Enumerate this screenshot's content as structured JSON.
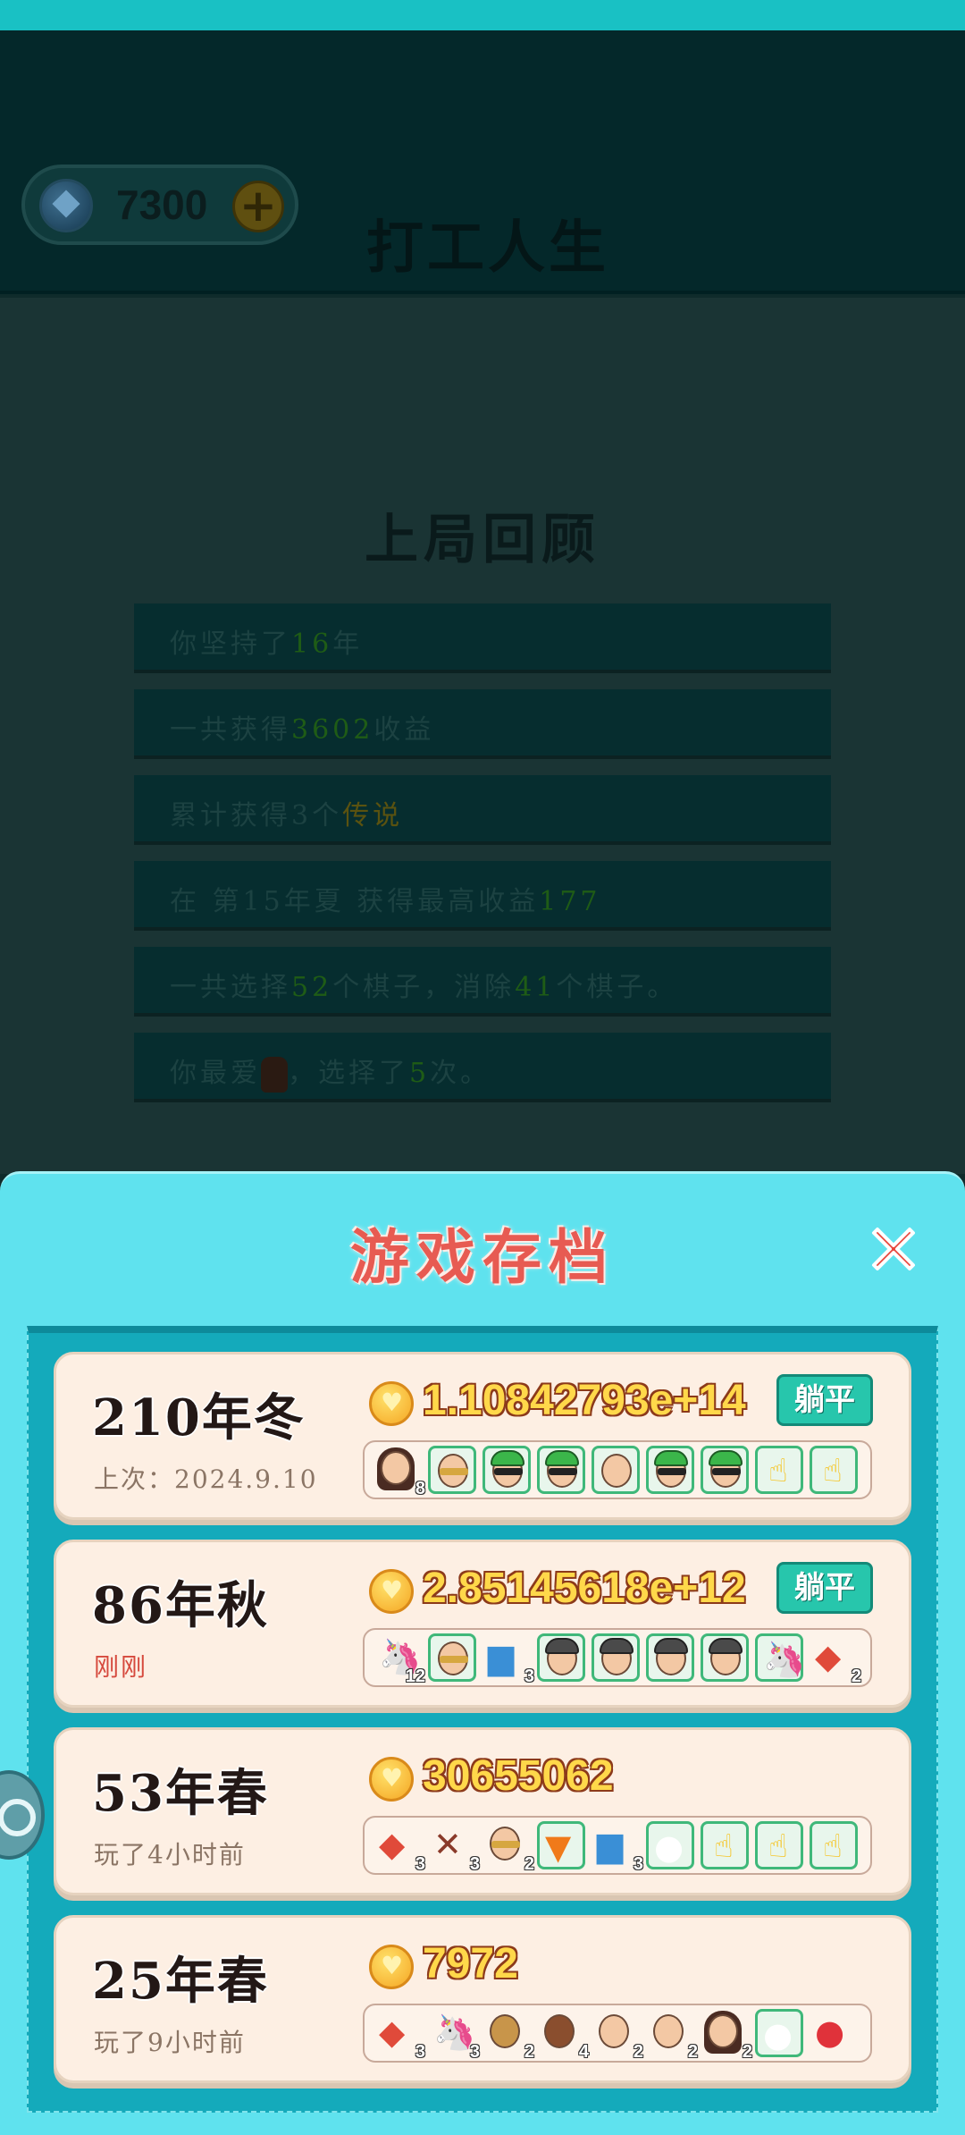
{
  "header": {
    "currency_value": "7300",
    "title": "打工人生"
  },
  "review": {
    "title": "上局回顾",
    "rows": [
      {
        "pre": "你坚持了",
        "hl": "16",
        "post": "年"
      },
      {
        "pre": "一共获得",
        "hl": "3602",
        "post": "收益"
      },
      {
        "pre": "累计获得3个",
        "hl": "传说",
        "post": ""
      },
      {
        "pre": "在 第15年夏 获得最高收益",
        "hl": "177",
        "post": ""
      },
      {
        "pre": "一共选择",
        "hl": "52",
        "post": "个棋子，消除",
        "hl2": "41",
        "post2": "个棋子。"
      },
      {
        "pre": "你最爱",
        "post": "，选择了",
        "hl": "5",
        "post2": "次。"
      }
    ]
  },
  "saves": {
    "title": "游戏存档",
    "cards": [
      {
        "season": "210年冬",
        "time": "上次：2024.9.10",
        "amount": "1.10842793e+14",
        "badge": "躺平",
        "pieces": [
          {
            "cnt": "8"
          },
          {},
          {},
          {},
          {},
          {},
          {},
          {},
          {}
        ]
      },
      {
        "season": "86年秋",
        "time": "刚刚",
        "amount": "2.85145618e+12",
        "badge": "躺平",
        "pieces": [
          {
            "cnt": "12"
          },
          {},
          {
            "cnt": "3"
          },
          {},
          {},
          {},
          {},
          {},
          {
            "cnt": "2"
          }
        ]
      },
      {
        "season": "53年春",
        "time": "玩了4小时前",
        "amount": "30655062",
        "pieces": [
          {
            "cnt": "3"
          },
          {
            "cnt": "3"
          },
          {
            "cnt": "2"
          },
          {},
          {
            "cnt": "3"
          },
          {},
          {},
          {},
          {}
        ]
      },
      {
        "season": "25年春",
        "time": "玩了9小时前",
        "amount": "7972",
        "pieces": [
          {
            "cnt": "3"
          },
          {
            "cnt": "3"
          },
          {
            "cnt": "2"
          },
          {
            "cnt": "4"
          },
          {
            "cnt": "2"
          },
          {
            "cnt": "2"
          },
          {
            "cnt": "2"
          },
          {},
          {}
        ]
      }
    ]
  },
  "icons": [
    "gem-icon",
    "plus-icon",
    "close-icon",
    "coin-icon",
    "settings-tab-icon"
  ]
}
